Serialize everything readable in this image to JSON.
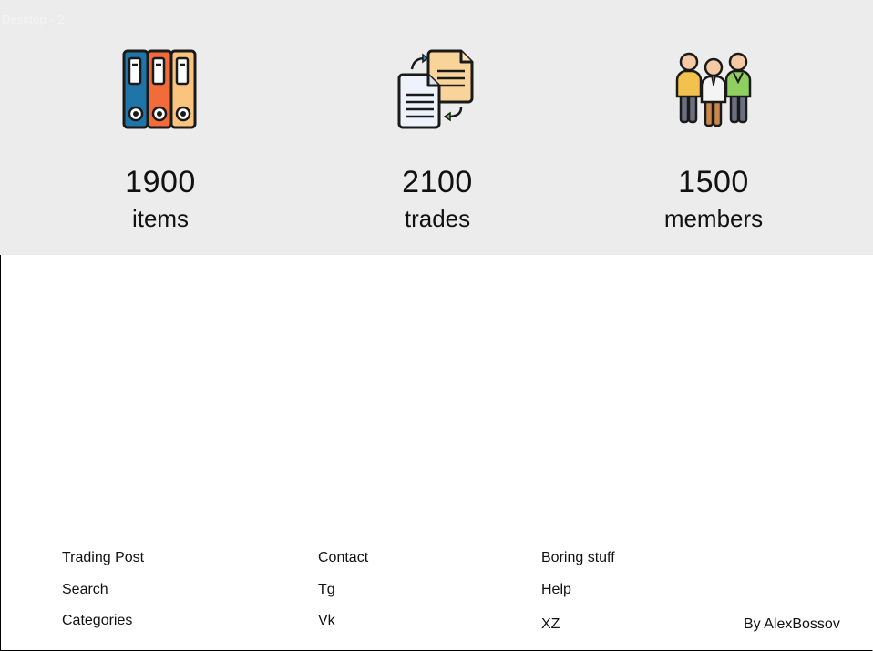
{
  "frame": {
    "title": "Desktop - 2"
  },
  "stats": [
    {
      "value": "1900",
      "label": "items",
      "icon": "binders-icon"
    },
    {
      "value": "2100",
      "label": "trades",
      "icon": "document-exchange-icon"
    },
    {
      "value": "1500",
      "label": "members",
      "icon": "people-group-icon"
    }
  ],
  "colors": {
    "band_background": "#ececec",
    "binder_blue": "#1f74a8",
    "binder_orange": "#f26b3a",
    "binder_yellow": "#fbc47e",
    "paper_light": "#eef3fb",
    "paper_tan": "#f9d49a"
  },
  "footer": {
    "col1": [
      "Trading Post",
      "Search",
      "Categories"
    ],
    "col2": [
      "Contact",
      "Tg",
      "Vk"
    ],
    "col3": [
      "Boring stuff",
      "Help",
      "XZ"
    ],
    "credit": "By AlexBossov"
  }
}
